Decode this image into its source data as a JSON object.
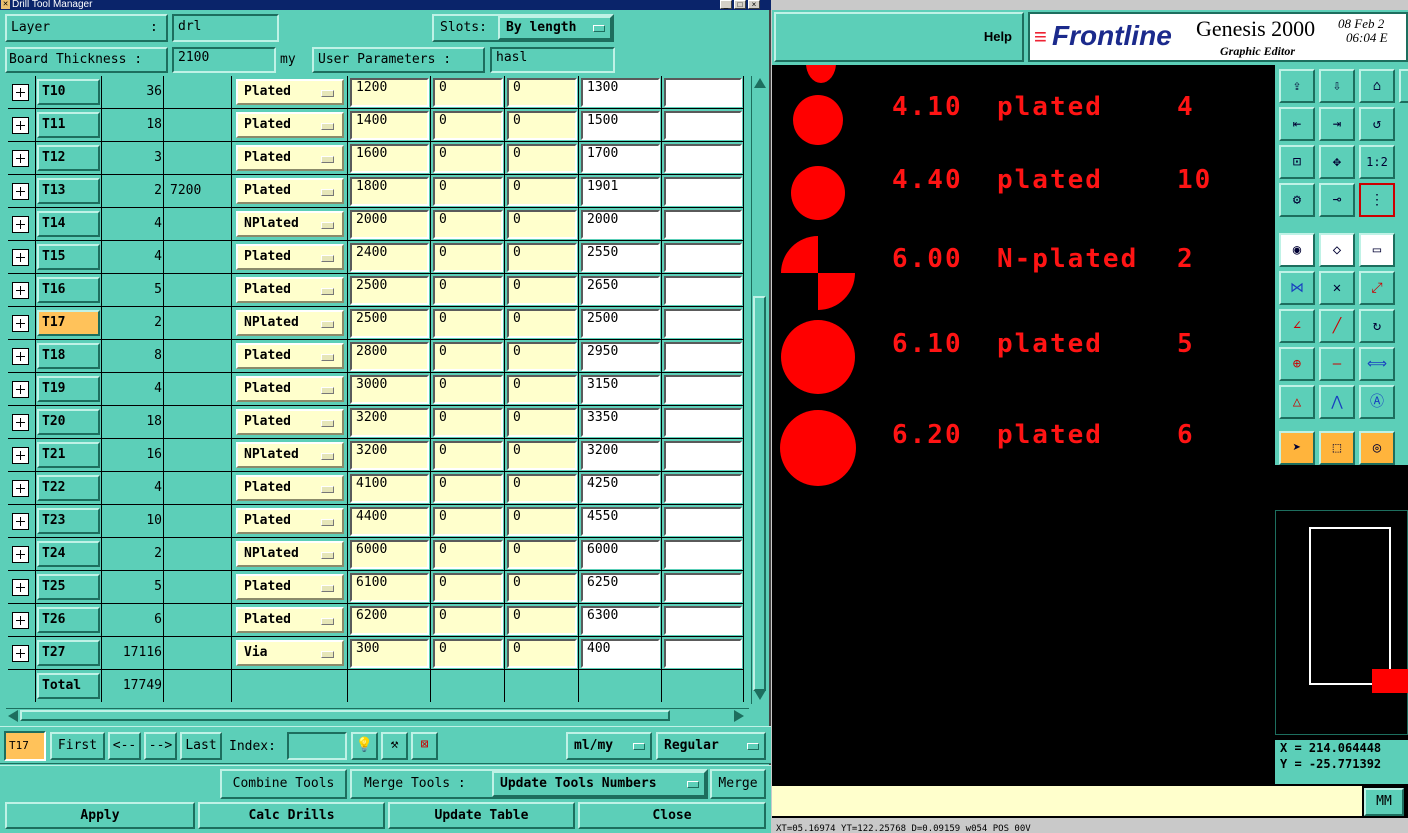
{
  "window_title": "Drill Tool Manager",
  "header": {
    "layer_label": "Layer",
    "layer_sep": ":",
    "layer_value": "drl",
    "slots_label": "Slots:",
    "slots_value": "By length",
    "thickness_label": "Board Thickness :",
    "thickness_value": "2100",
    "thickness_unit": "my",
    "user_params_label": "User Parameters :",
    "user_params_value": "hasl"
  },
  "rows": [
    {
      "tool": "T10",
      "count": "36",
      "extra": "",
      "type": "Plated",
      "c1": "1200",
      "c2": "0",
      "c3": "0",
      "c4": "1300",
      "c5": "",
      "selected": false
    },
    {
      "tool": "T11",
      "count": "18",
      "extra": "",
      "type": "Plated",
      "c1": "1400",
      "c2": "0",
      "c3": "0",
      "c4": "1500",
      "c5": "",
      "selected": false
    },
    {
      "tool": "T12",
      "count": "3",
      "extra": "",
      "type": "Plated",
      "c1": "1600",
      "c2": "0",
      "c3": "0",
      "c4": "1700",
      "c5": "",
      "selected": false
    },
    {
      "tool": "T13",
      "count": "2",
      "extra": "7200",
      "type": "Plated",
      "c1": "1800",
      "c2": "0",
      "c3": "0",
      "c4": "1901",
      "c5": "",
      "selected": false
    },
    {
      "tool": "T14",
      "count": "4",
      "extra": "",
      "type": "NPlated",
      "c1": "2000",
      "c2": "0",
      "c3": "0",
      "c4": "2000",
      "c5": "",
      "selected": false
    },
    {
      "tool": "T15",
      "count": "4",
      "extra": "",
      "type": "Plated",
      "c1": "2400",
      "c2": "0",
      "c3": "0",
      "c4": "2550",
      "c5": "",
      "selected": false
    },
    {
      "tool": "T16",
      "count": "5",
      "extra": "",
      "type": "Plated",
      "c1": "2500",
      "c2": "0",
      "c3": "0",
      "c4": "2650",
      "c5": "",
      "selected": false
    },
    {
      "tool": "T17",
      "count": "2",
      "extra": "",
      "type": "NPlated",
      "c1": "2500",
      "c2": "0",
      "c3": "0",
      "c4": "2500",
      "c5": "",
      "selected": true
    },
    {
      "tool": "T18",
      "count": "8",
      "extra": "",
      "type": "Plated",
      "c1": "2800",
      "c2": "0",
      "c3": "0",
      "c4": "2950",
      "c5": "",
      "selected": false
    },
    {
      "tool": "T19",
      "count": "4",
      "extra": "",
      "type": "Plated",
      "c1": "3000",
      "c2": "0",
      "c3": "0",
      "c4": "3150",
      "c5": "",
      "selected": false
    },
    {
      "tool": "T20",
      "count": "18",
      "extra": "",
      "type": "Plated",
      "c1": "3200",
      "c2": "0",
      "c3": "0",
      "c4": "3350",
      "c5": "",
      "selected": false
    },
    {
      "tool": "T21",
      "count": "16",
      "extra": "",
      "type": "NPlated",
      "c1": "3200",
      "c2": "0",
      "c3": "0",
      "c4": "3200",
      "c5": "",
      "selected": false
    },
    {
      "tool": "T22",
      "count": "4",
      "extra": "",
      "type": "Plated",
      "c1": "4100",
      "c2": "0",
      "c3": "0",
      "c4": "4250",
      "c5": "",
      "selected": false
    },
    {
      "tool": "T23",
      "count": "10",
      "extra": "",
      "type": "Plated",
      "c1": "4400",
      "c2": "0",
      "c3": "0",
      "c4": "4550",
      "c5": "",
      "selected": false
    },
    {
      "tool": "T24",
      "count": "2",
      "extra": "",
      "type": "NPlated",
      "c1": "6000",
      "c2": "0",
      "c3": "0",
      "c4": "6000",
      "c5": "",
      "selected": false
    },
    {
      "tool": "T25",
      "count": "5",
      "extra": "",
      "type": "Plated",
      "c1": "6100",
      "c2": "0",
      "c3": "0",
      "c4": "6250",
      "c5": "",
      "selected": false
    },
    {
      "tool": "T26",
      "count": "6",
      "extra": "",
      "type": "Plated",
      "c1": "6200",
      "c2": "0",
      "c3": "0",
      "c4": "6300",
      "c5": "",
      "selected": false
    },
    {
      "tool": "T27",
      "count": "17116",
      "extra": "",
      "type": "Via",
      "c1": "300",
      "c2": "0",
      "c3": "0",
      "c4": "400",
      "c5": "",
      "selected": false
    }
  ],
  "total": {
    "label": "Total",
    "count": "17749"
  },
  "nav": {
    "current_tool": "T17",
    "first": "First",
    "prev": "<--",
    "next": "-->",
    "last": "Last",
    "index_label": "Index:",
    "index_value": "",
    "units": "ml/my",
    "mode": "Regular"
  },
  "actions": {
    "combine": "Combine Tools",
    "merge_label": "Merge Tools :",
    "update_numbers": "Update Tools Numbers",
    "merge": "Merge",
    "apply": "Apply",
    "calc": "Calc Drills",
    "update_table": "Update Table",
    "close": "Close"
  },
  "genesis": {
    "help": "Help",
    "brand": "Frontline",
    "product": "Genesis 2000",
    "subtitle": "Graphic Editor",
    "date": "08 Feb 2",
    "time": "06:04 E",
    "annotations": [
      {
        "size": "4.10",
        "kind": "plated",
        "count": "4"
      },
      {
        "size": "4.40",
        "kind": "plated",
        "count": "10"
      },
      {
        "size": "6.00",
        "kind": "N-plated",
        "count": "2"
      },
      {
        "size": "6.10",
        "kind": "plated",
        "count": "5"
      },
      {
        "size": "6.20",
        "kind": "plated",
        "count": "6"
      }
    ],
    "coord_x": "X = 214.064448",
    "coord_y": "Y = -25.771392",
    "units_btn": "MM",
    "status_line": "XT=05.16974 YT=122.25768 D=0.09159 w054 POS 00V"
  },
  "colors": {
    "panel": "#5ccfb8",
    "highlight": "#ffc25a",
    "input": "#ffffcc",
    "pad": "#ff0000"
  }
}
